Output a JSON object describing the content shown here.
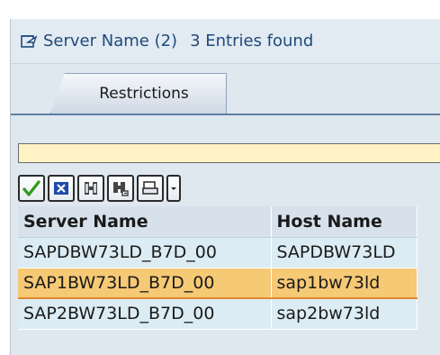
{
  "dialog": {
    "title": "Server Name (2)",
    "entries_found": "3 Entries found"
  },
  "tabs": [
    {
      "label": "Restrictions"
    }
  ],
  "toolbar": {
    "buttons": [
      {
        "name": "checkmark-icon",
        "color": "#2f9a1d"
      },
      {
        "name": "cancel-icon",
        "color": "#1f4aa8"
      },
      {
        "name": "find-icon"
      },
      {
        "name": "find-next-icon"
      },
      {
        "name": "print-icon"
      },
      {
        "name": "dropdown-icon"
      }
    ]
  },
  "table": {
    "columns": [
      "Server Name",
      "Host Name"
    ],
    "rows": [
      {
        "server": "SAPDBW73LD_B7D_00",
        "host": "SAPDBW73LD",
        "selected": false
      },
      {
        "server": "SAP1BW73LD_B7D_00",
        "host": "sap1bw73ld",
        "selected": true
      },
      {
        "server": "SAP2BW73LD_B7D_00",
        "host": "sap2bw73ld",
        "selected": false
      }
    ]
  },
  "colors": {
    "panel_bg": "#dfe7ef",
    "title_text": "#1f4a7a",
    "message_bar": "#fff3c6",
    "row_bg": "#dcecf4",
    "selected_row_bg": "#f6c975",
    "header_bg": "#d6e1ec"
  }
}
